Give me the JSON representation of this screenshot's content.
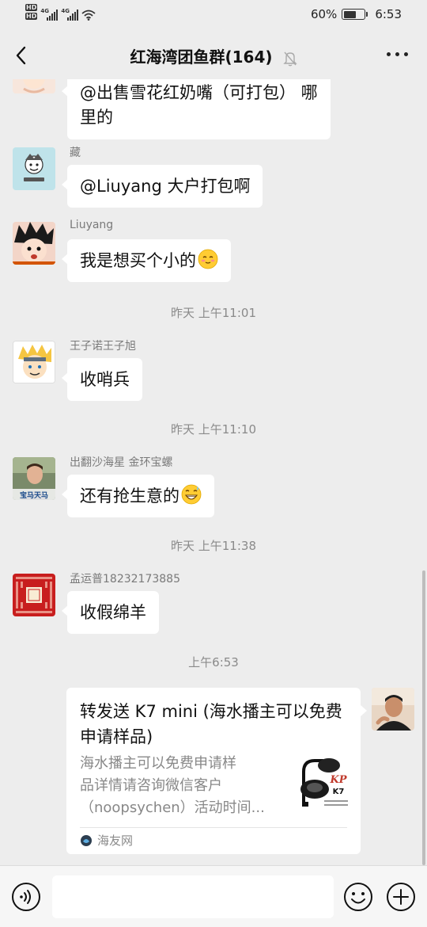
{
  "status_bar": {
    "sim1": "HD",
    "sim2": "HD",
    "net1": "4G",
    "net2": "4G",
    "battery": "60%",
    "battery_level": 0.6,
    "time": "6:53"
  },
  "header": {
    "title": "红海湾团鱼群(164)",
    "icons": [
      "back-icon",
      "mute-bell-icon",
      "more-icon"
    ]
  },
  "messages": [
    {
      "type": "text",
      "sender": "",
      "text_lines": [
        "@出售雪花红奶嘴（可打包） 哪",
        "里的"
      ],
      "avatar_icon": "avatar-cartoon-girl"
    },
    {
      "type": "text",
      "sender": "藏",
      "text": "@Liuyang  大户打包啊",
      "avatar_icon": "avatar-sticker"
    },
    {
      "type": "text",
      "sender": "Liuyang",
      "text": "我是想买个小的",
      "emoji": "blush-smile-emoji",
      "avatar_icon": "avatar-goku"
    },
    {
      "type": "time",
      "text": "昨天 上午11:01"
    },
    {
      "type": "text",
      "sender": "王子诺王子旭",
      "text": "收哨兵",
      "avatar_icon": "avatar-naruto"
    },
    {
      "type": "time",
      "text": "昨天 上午11:10"
    },
    {
      "type": "text",
      "sender": "出翻沙海星 金环宝螺",
      "text": "还有抢生意的",
      "emoji": "grin-sweat-emoji",
      "avatar_icon": "avatar-person-photo"
    },
    {
      "type": "time",
      "text": "昨天 上午11:38"
    },
    {
      "type": "text",
      "sender": "孟运普18232173885",
      "text": "收假绵羊",
      "avatar_icon": "avatar-red-seal"
    },
    {
      "type": "time",
      "text": "上午6:53"
    },
    {
      "type": "link",
      "self": true,
      "title": "转发送 K7 mini (海水播主可以免费申请样品)",
      "description_lines": [
        "海水播主可以免费申请样",
        "品详情请咨询微信客户",
        "（noopsychen）活动时间..."
      ],
      "source": "海友网",
      "thumb_label": "K7",
      "avatar_icon": "avatar-man-photo"
    }
  ],
  "input_bar": {
    "placeholder": "",
    "icons": [
      "voice-icon",
      "emoji-icon",
      "plus-icon"
    ]
  },
  "colors": {
    "background": "#ededed",
    "bubble": "#ffffff",
    "text": "#111111",
    "meta": "#8a8a8a"
  }
}
